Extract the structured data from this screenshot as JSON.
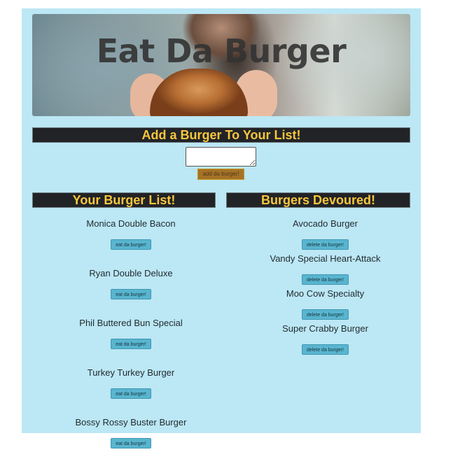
{
  "header": {
    "title": "Eat Da Burger"
  },
  "add_section": {
    "heading": "Add a Burger To Your List!",
    "textarea_value": "",
    "button_label": "add da burger!"
  },
  "burger_list": {
    "heading": "Your Burger List!",
    "items": [
      {
        "name": "Monica Double Bacon",
        "button_label": "eat da burger!"
      },
      {
        "name": "Ryan Double Deluxe",
        "button_label": "eat da burger!"
      },
      {
        "name": "Phil Buttered Bun Special",
        "button_label": "eat da burger!"
      },
      {
        "name": "Turkey Turkey Burger",
        "button_label": "eat da burger!"
      },
      {
        "name": "Bossy Rossy Buster Burger",
        "button_label": "eat da burger!"
      }
    ]
  },
  "devoured_list": {
    "heading": "Burgers Devoured!",
    "items": [
      {
        "name": "Avocado Burger",
        "button_label": "delete da burger!"
      },
      {
        "name": "Vandy Special Heart-Attack",
        "button_label": "delete da burger!"
      },
      {
        "name": "Moo Cow Specialty",
        "button_label": "delete da burger!"
      },
      {
        "name": "Super Crabby Burger",
        "button_label": "delete da burger!"
      }
    ]
  },
  "colors": {
    "page_background": "#bce7f4",
    "heading_bar": "#222326",
    "heading_text": "#f6c63e",
    "add_button": "#a57226",
    "item_button": "#59b5cf"
  }
}
